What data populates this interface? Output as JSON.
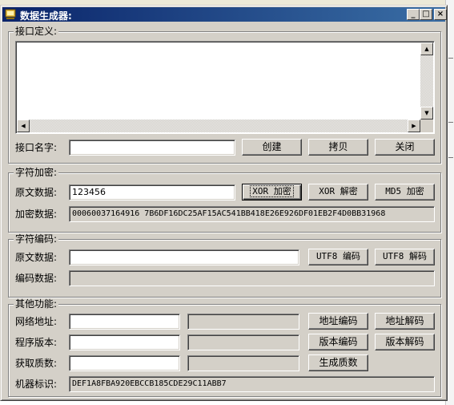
{
  "window": {
    "title": "数据生成器:",
    "controls": {
      "minimize": "_",
      "maximize": "□",
      "close": "×"
    }
  },
  "interface_group": {
    "legend": "接口定义:",
    "definition_text": "",
    "name_label": "接口名字:",
    "name_value": "",
    "create_label": "创建",
    "copy_label": "拷贝",
    "close_label": "关闭"
  },
  "encrypt_group": {
    "legend": "字符加密:",
    "plain_label": "原文数据:",
    "plain_value": "123456",
    "xor_encrypt_label": "XOR 加密",
    "xor_decrypt_label": "XOR 解密",
    "md5_encrypt_label": "MD5 加密",
    "cipher_label": "加密数据:",
    "cipher_value": "00060037164916 7B6DF16DC25AF15AC541BB418E26E926DF01EB2F4D0BB31968"
  },
  "encode_group": {
    "legend": "字符编码:",
    "plain_label": "原文数据:",
    "plain_value": "",
    "utf8_encode_label": "UTF8 编码",
    "utf8_decode_label": "UTF8 解码",
    "encoded_label": "编码数据:",
    "encoded_value": ""
  },
  "other_group": {
    "legend": "其他功能:",
    "url_label": "网络地址:",
    "url_value": "",
    "url_result": "",
    "url_encode_label": "地址编码",
    "url_decode_label": "地址解码",
    "version_label": "程序版本:",
    "version_value": "",
    "version_result": "",
    "version_encode_label": "版本编码",
    "version_decode_label": "版本解码",
    "prime_label": "获取质数:",
    "prime_value": "",
    "prime_result": "",
    "prime_generate_label": "生成质数",
    "machine_label": "机器标识:",
    "machine_value": "DEF1A8FBA920EBCCB185CDE29C11ABB7"
  },
  "icons": [
    "app-icon",
    "minimize-icon",
    "maximize-icon",
    "close-icon",
    "scroll-up-icon",
    "scroll-down-icon",
    "scroll-left-icon",
    "scroll-right-icon"
  ],
  "colors": {
    "titlebar_start": "#0a246a",
    "titlebar_end": "#3a6ea5",
    "face": "#d4d0c8"
  }
}
